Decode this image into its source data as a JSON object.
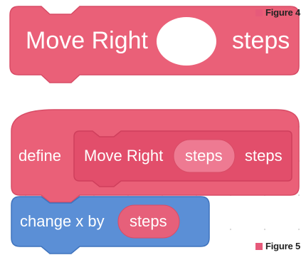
{
  "figure4": {
    "label": "Figure 4",
    "block": {
      "text_before": "Move Right",
      "text_after": "steps"
    }
  },
  "figure5": {
    "label": "Figure 5",
    "define_block": {
      "keyword": "define",
      "inner": {
        "text_before": "Move Right",
        "param": "steps",
        "text_after": "steps"
      }
    },
    "motion_block": {
      "text": "change x by",
      "param": "steps"
    }
  },
  "colors": {
    "custom_block": "#ea6078",
    "custom_block_border": "#d84c66",
    "custom_inner": "#e24e6b",
    "param_pill": "#ee7a92",
    "motion_block": "#5b8fd6",
    "motion_border": "#3f73bd",
    "motion_pill": "#e6607a",
    "accent": "#e65a7a"
  }
}
